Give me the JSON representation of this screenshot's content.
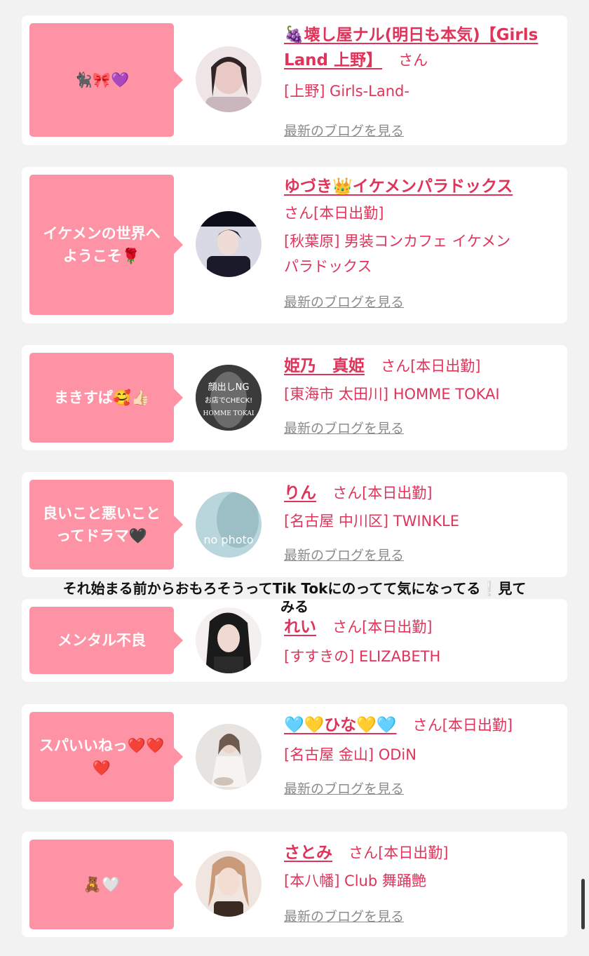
{
  "cards": [
    {
      "comment": "🐈‍⬛🎀💜",
      "name_line1": "🍇壊し屋ナル(明日も本気)【Girls",
      "name_line2": "Land 上野】",
      "san": "さん",
      "shop": "[上野] Girls-Land-",
      "blog": "最新のブログを見る",
      "avatar_colors": [
        "#efe5e6",
        "#c9b7bd",
        "#6d5a60"
      ]
    },
    {
      "comment": "イケメンの世界へようこそ🌹",
      "name_line1": "ゆづき👑イケメンパラドックス",
      "san_status": "さん[本日出勤]",
      "shop_line1": "[秋葉原] 男装コンカフェ イケメン",
      "shop_line2": "パラドックス",
      "blog": "最新のブログを見る",
      "avatar_colors": [
        "#d9d9e6",
        "#4a4a66",
        "#0e0e1a"
      ]
    },
    {
      "comment": "まきすぱ🥰👍🏻",
      "name_line1": "姫乃　真姫",
      "san_status": "さん[本日出勤]",
      "shop": "[東海市 太田川] HOMME TOKAI",
      "blog": "最新のブログを見る",
      "avatar_text1": "顔出しNG",
      "avatar_text2": "お店でCHECK!",
      "avatar_text3": "HOMME TOKAI",
      "avatar_colors": [
        "#3b3b3b",
        "#8c8c8c",
        "#ffffff"
      ]
    },
    {
      "comment": "良いこと悪いことってドラマ🖤",
      "name_line1": "りん",
      "san_status": "さん[本日出勤]",
      "shop": "[名古屋 中川区] TWINKLE",
      "blog": "最新のブログを見る",
      "avatar_text1": "no photo",
      "avatar_colors": [
        "#b9d6dc",
        "#7fa7b0",
        "#ffffff"
      ]
    },
    {
      "comment": "メンタル不良",
      "name_line1": "れい",
      "san_status": "さん[本日出勤]",
      "shop": "[すすきの] ELIZABETH",
      "avatar_colors": [
        "#f4f0ef",
        "#1a1a1a",
        "#c7a89b"
      ]
    },
    {
      "comment": "スパいいねっ❤️❤️❤️",
      "name_line1": "🩵💛ひな💛🩵",
      "san_status": "さん[本日出勤]",
      "shop": "[名古屋 金山] ODiN",
      "blog": "最新のブログを見る",
      "avatar_colors": [
        "#e6e3e1",
        "#cfc3b9",
        "#8e7a6e"
      ]
    },
    {
      "comment": "🧸🤍",
      "name_line1": "さとみ",
      "san_status": "さん[本日出勤]",
      "shop": "[本八幡] Club 舞踊艶",
      "blog": "最新のブログを見る",
      "avatar_colors": [
        "#f0e6df",
        "#c99b7b",
        "#3a2a22"
      ]
    }
  ],
  "overlay": {
    "line1": "それ始まる前からおもろそうってTik Tokにのってて気になってる❕見て",
    "line2": "みる"
  },
  "colors": {
    "accent": "#e0335a",
    "bubble": "#ff93a6",
    "background": "#f2f2f3"
  }
}
